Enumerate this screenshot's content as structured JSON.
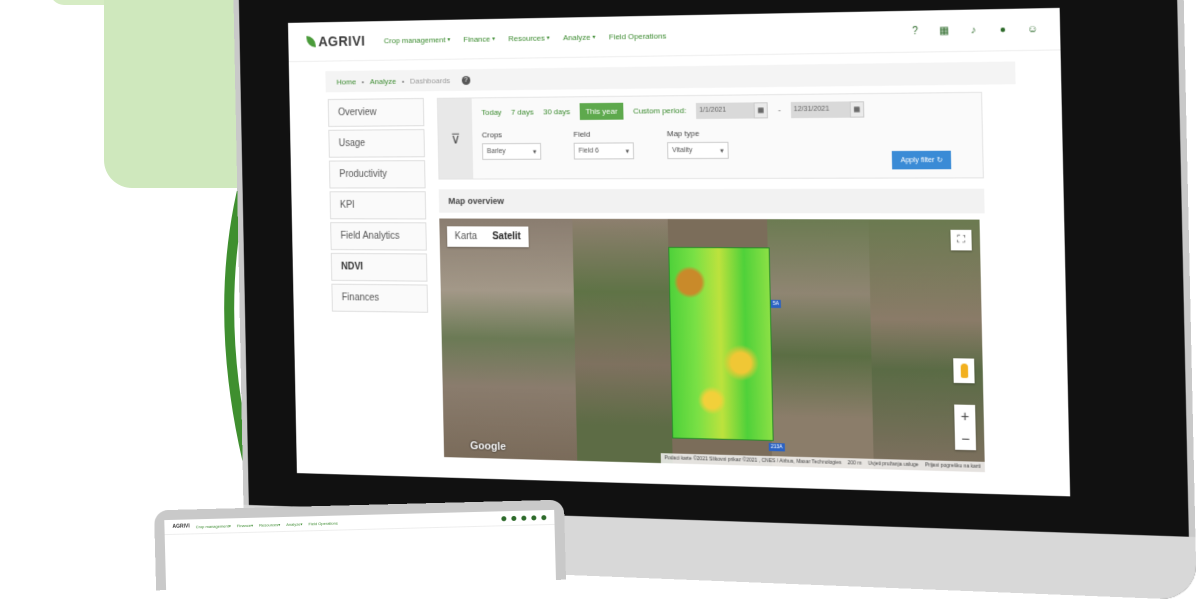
{
  "brand": {
    "name": "AGRIVI"
  },
  "nav": {
    "items": [
      {
        "label": "Crop management",
        "has_caret": true
      },
      {
        "label": "Finance",
        "has_caret": true
      },
      {
        "label": "Resources",
        "has_caret": true
      },
      {
        "label": "Analyze",
        "has_caret": true
      },
      {
        "label": "Field Operations",
        "has_caret": false
      }
    ],
    "icons": [
      "help-icon",
      "calendar-icon",
      "bell-icon",
      "chat-icon",
      "user-icon"
    ]
  },
  "breadcrumb": {
    "home": "Home",
    "analyze": "Analyze",
    "current": "Dashboards",
    "sep": "•"
  },
  "sidebar": {
    "items": [
      {
        "label": "Overview"
      },
      {
        "label": "Usage"
      },
      {
        "label": "Productivity"
      },
      {
        "label": "KPI"
      },
      {
        "label": "Field Analytics"
      },
      {
        "label": "NDVI",
        "active": true
      },
      {
        "label": "Finances"
      }
    ]
  },
  "filters": {
    "periods": [
      "Today",
      "7 days",
      "30 days",
      "This year"
    ],
    "selected_period": "This year",
    "custom_label": "Custom period:",
    "start_date": "1/1/2021",
    "date_sep": "-",
    "end_date": "12/31/2021",
    "crops_label": "Crops",
    "crops_value": "Barley",
    "field_label": "Field",
    "field_value": "Field 6",
    "maptype_label": "Map type",
    "maptype_value": "Vitality",
    "apply_label": "Apply filter"
  },
  "map": {
    "title": "Map overview",
    "tab_map": "Karta",
    "tab_satellite": "Satelit",
    "active_tab": "Satelit",
    "google": "Google",
    "footer": [
      "Podaci karte ©2021 Slikovni prikaz ©2021 , CNES / Airbus, Maxar Technologies",
      "200 m",
      "Uvjeti pružanja usluge",
      "Prijavi pogrešku na karti"
    ],
    "road_labels": [
      "5A",
      "213A"
    ],
    "zoom_in": "+",
    "zoom_out": "−"
  },
  "laptop": {
    "nav": [
      "Crop management▾",
      "Finance▾",
      "Resources▾",
      "Analyze▾",
      "Field Operations"
    ]
  },
  "colors": {
    "accent": "#3a8a2e",
    "brand_green": "#4a9b3a",
    "apply_blue": "#3a8bd6"
  }
}
